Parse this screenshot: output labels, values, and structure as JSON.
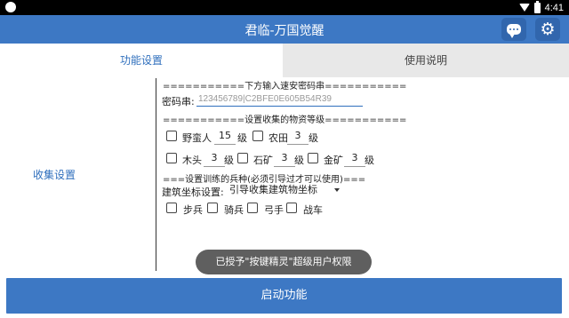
{
  "status_bar": {
    "time": "4:41"
  },
  "app_bar": {
    "title": "君临-万国觉醒"
  },
  "tabs": [
    {
      "label": "功能设置",
      "active": true
    },
    {
      "label": "使用说明",
      "active": false
    }
  ],
  "side_label": "收集设置",
  "form": {
    "code_header": "===========下方输入速安密码串===========",
    "code_label": "密码串:",
    "code_value": "123456789|C2BFE0E605B54R39",
    "level_header": "===========设置收集的物资等级===========",
    "resources_row1": [
      {
        "label": "野蛮人",
        "level": "15",
        "unit": "级"
      },
      {
        "label": "农田",
        "level": "3",
        "unit": "级"
      }
    ],
    "resources_row2": [
      {
        "label": "木头",
        "level": "3",
        "unit": "级"
      },
      {
        "label": "石矿",
        "level": "3",
        "unit": "级"
      },
      {
        "label": "金矿",
        "level": "3",
        "unit": "级"
      }
    ],
    "troop_header": "===设置训练的兵种(必须引导过才可以使用)===",
    "coord_label": "建筑坐标设置:",
    "coord_select": "引导收集建筑物坐标",
    "troops": [
      "步兵",
      "骑兵",
      "弓手",
      "战车"
    ]
  },
  "toast": "已授予\"按键精灵\"超级用户权限",
  "start_button": "启动功能",
  "colors": {
    "accent": "#3d78c4",
    "link": "#2f6fbd"
  }
}
